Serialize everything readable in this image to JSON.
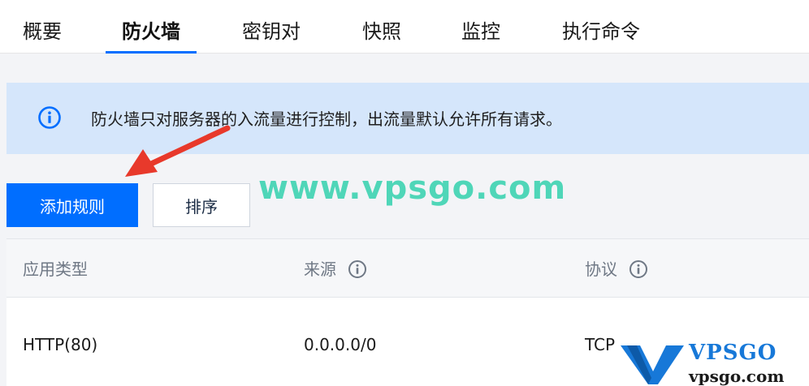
{
  "tabs": [
    {
      "label": "概要"
    },
    {
      "label": "防火墙"
    },
    {
      "label": "密钥对"
    },
    {
      "label": "快照"
    },
    {
      "label": "监控"
    },
    {
      "label": "执行命令"
    }
  ],
  "active_tab": "防火墙",
  "notice": {
    "icon": "info-circle-icon",
    "text": "防火墙只对服务器的入流量进行控制，出流量默认允许所有请求。"
  },
  "toolbar": {
    "add_rule_label": "添加规则",
    "sort_label": "排序"
  },
  "watermark": {
    "text": "www.vpsgo.com",
    "logo_big": "VPSGO",
    "logo_small": "vpsgo.com"
  },
  "table": {
    "columns": [
      {
        "label": "应用类型"
      },
      {
        "label": "来源"
      },
      {
        "label": "协议"
      }
    ],
    "rows": [
      {
        "app_type": "HTTP(80)",
        "source": "0.0.0.0/0",
        "protocol": "TCP"
      }
    ]
  },
  "colors": {
    "accent": "#006eff",
    "notice_bg": "#d5e6fb",
    "watermark_green": "#4fd6b8",
    "arrow_red": "#e8392b"
  }
}
